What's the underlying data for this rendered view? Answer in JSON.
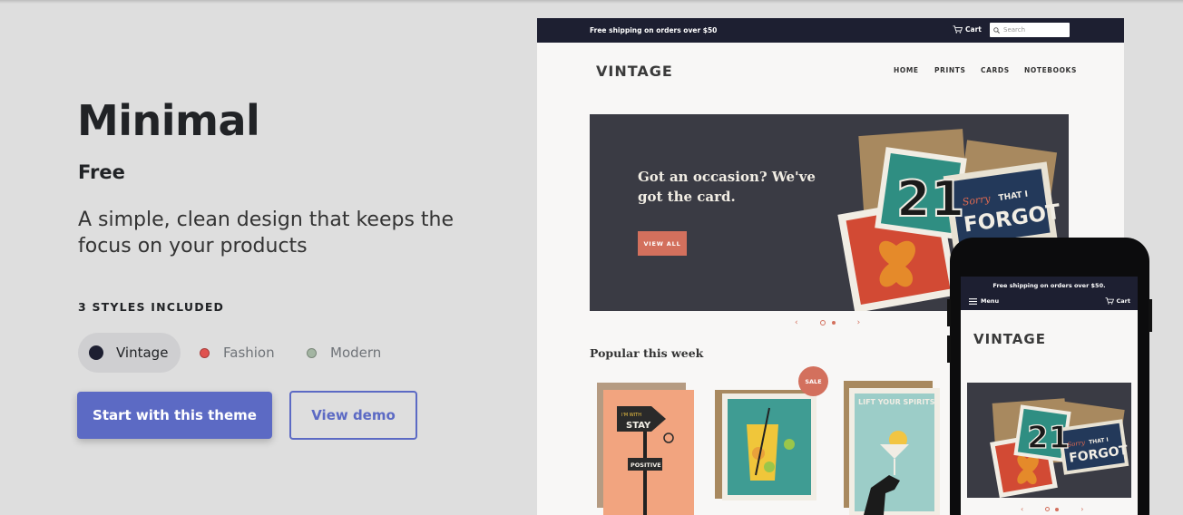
{
  "theme": {
    "name": "Minimal",
    "price": "Free",
    "description": "A simple, clean design that keeps the focus on your products",
    "styles_heading": "3 STYLES INCLUDED",
    "styles": [
      {
        "label": "Vintage",
        "color": "#1d1f31",
        "selected": true
      },
      {
        "label": "Fashion",
        "color": "#e0524f",
        "selected": false
      },
      {
        "label": "Modern",
        "color": "#a3b5a2",
        "selected": false
      }
    ],
    "primary_button": "Start with this theme",
    "secondary_button": "View demo",
    "accent_color": "#5c6ac4"
  },
  "desktop_preview": {
    "shipping_notice": "Free shipping on orders over $50",
    "cart_label": "Cart",
    "search_placeholder": "Search",
    "logo": "VINTAGE",
    "nav": [
      "HOME",
      "PRINTS",
      "CARDS",
      "NOTEBOOKS"
    ],
    "hero_heading": "Got an occasion? We've got the card.",
    "hero_button": "VIEW ALL",
    "hero_card_number": "21",
    "hero_card_text": [
      "Sorry",
      "THAT I",
      "FORGOT"
    ],
    "section_heading": "Popular this week",
    "sale_badge": "SALE",
    "product_texts": {
      "sign_top": "I'M WITH",
      "sign_word": "STAY",
      "sign_bottom": "POSITIVE",
      "poster_title": "LIFT YOUR SPIRITS"
    }
  },
  "mobile_preview": {
    "shipping_notice": "Free shipping on orders over $50.",
    "menu_label": "Menu",
    "cart_label": "Cart",
    "logo": "VINTAGE"
  }
}
